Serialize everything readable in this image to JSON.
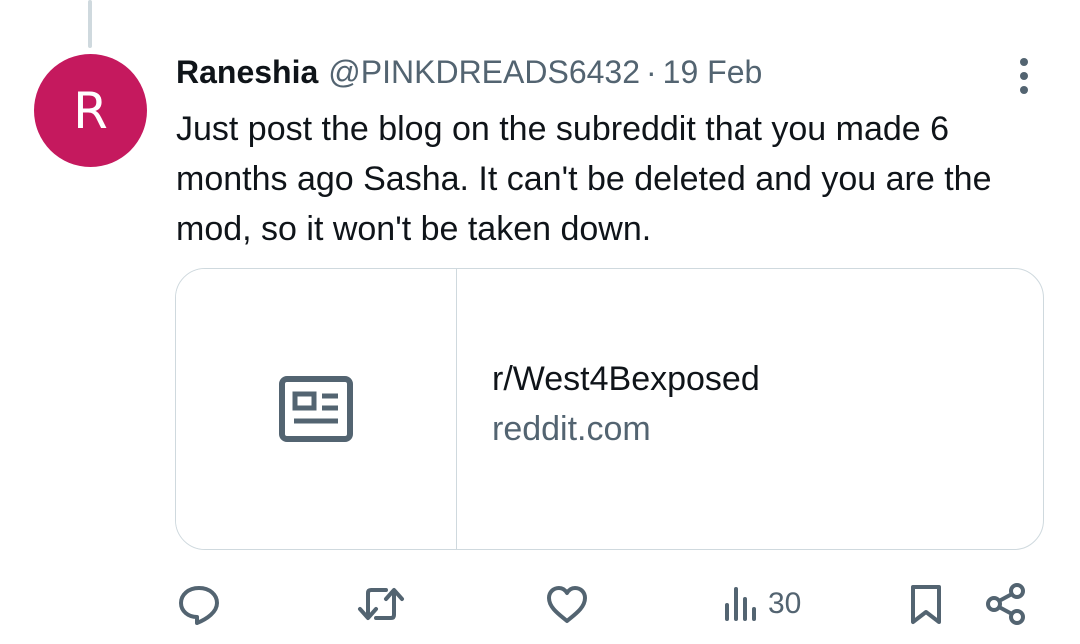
{
  "tweet": {
    "avatar_letter": "R",
    "avatar_color": "#c5195e",
    "display_name": "Raneshia",
    "handle": "@PINKDREADS6432",
    "separator": "·",
    "timestamp": "19 Feb",
    "text": "Just post the blog on the subreddit that you made 6 months ago Sasha. It can't be deleted and you are the mod, so it won't be taken down."
  },
  "link_card": {
    "title": "r/West4Bexposed",
    "domain": "reddit.com",
    "thumbnail_icon": "newspaper-icon"
  },
  "actions": {
    "reply_icon": "reply-icon",
    "retweet_icon": "retweet-icon",
    "like_icon": "heart-icon",
    "views_icon": "views-chart-icon",
    "views_count": "30",
    "bookmark_icon": "bookmark-icon",
    "share_icon": "share-icon"
  },
  "colors": {
    "text_primary": "#0f1419",
    "text_secondary": "#536471",
    "border": "#cfd9de"
  }
}
